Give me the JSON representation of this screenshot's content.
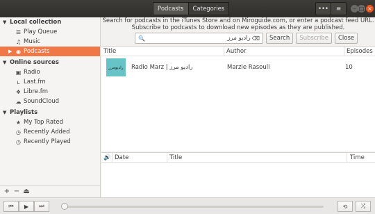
{
  "header": {
    "tabs": [
      {
        "label": "Podcasts",
        "active": true
      },
      {
        "label": "Categories",
        "active": false
      }
    ],
    "more_icon": "more-icon",
    "menu_icon": "hamburger-icon",
    "window_controls": [
      "minimize-icon",
      "maximize-icon",
      "close-icon"
    ]
  },
  "sidebar": {
    "groups": [
      {
        "label": "Local collection",
        "items": [
          {
            "label": "Play Queue",
            "icon": "queue-icon"
          },
          {
            "label": "Music",
            "icon": "music-icon"
          },
          {
            "label": "Podcasts",
            "icon": "podcast-icon",
            "selected": true
          }
        ]
      },
      {
        "label": "Online sources",
        "items": [
          {
            "label": "Radio",
            "icon": "radio-icon"
          },
          {
            "label": "Last.fm",
            "icon": "lastfm-icon"
          },
          {
            "label": "Libre.fm",
            "icon": "librefm-icon"
          },
          {
            "label": "SoundCloud",
            "icon": "soundcloud-icon"
          }
        ]
      },
      {
        "label": "Playlists",
        "items": [
          {
            "label": "My Top Rated",
            "icon": "star-icon"
          },
          {
            "label": "Recently Added",
            "icon": "clock-icon"
          },
          {
            "label": "Recently Played",
            "icon": "clock-icon"
          }
        ]
      }
    ],
    "footer": [
      "+",
      "−",
      "⏏"
    ]
  },
  "main": {
    "info_line1": "Search for podcasts in the iTunes Store and on Miroguide.com, or enter a podcast feed URL.",
    "info_line2": "Subscribe to podcasts to download new episodes as they are published.",
    "search_value": "رادیو مرز",
    "buttons": {
      "search": "Search",
      "subscribe": "Subscribe",
      "close": "Close"
    },
    "podcast_columns": [
      "Title",
      "Author",
      "Episodes"
    ],
    "podcasts": [
      {
        "title": "Radio Marz | رادیو مرز",
        "author": "Marzie Rasouli",
        "episodes": "10",
        "thumb_text": "رادیومرز"
      }
    ],
    "episode_columns": [
      "Date",
      "Title",
      "Time"
    ]
  },
  "player": {
    "buttons": [
      "previous-icon",
      "play-icon",
      "next-icon"
    ],
    "repeat_icon": "repeat-icon",
    "shuffle_icon": "shuffle-icon"
  },
  "colors": {
    "accent": "#f07746",
    "header_bg": "#3d3c39",
    "close_button": "#e95420"
  }
}
